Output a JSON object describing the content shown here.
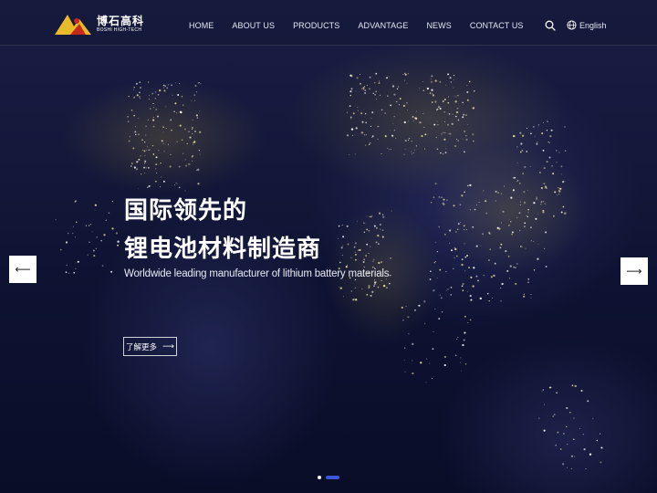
{
  "brand": {
    "name_cn": "博石高科",
    "name_en": "BOSHI HIGH-TECH",
    "colors": {
      "gold": "#e8b92a",
      "red": "#c8281e"
    }
  },
  "nav": {
    "items": [
      "HOME",
      "ABOUT US",
      "PRODUCTS",
      "ADVANTAGE",
      "NEWS",
      "CONTACT US"
    ]
  },
  "header_tools": {
    "search_icon": "search-icon",
    "language_icon": "globe-icon",
    "language_label": "English"
  },
  "hero": {
    "title_line1": "国际领先的",
    "title_line2": "锂电池材料制造商",
    "subtitle": "Worldwide leading manufacturer of lithium battery materials",
    "cta_label": "了解更多",
    "cta_icon": "arrow-right-icon",
    "prev_icon": "arrow-left-icon",
    "next_icon": "arrow-right-icon"
  },
  "pager": {
    "slides": 2,
    "active": 2,
    "active_color": "#3a55d8"
  }
}
